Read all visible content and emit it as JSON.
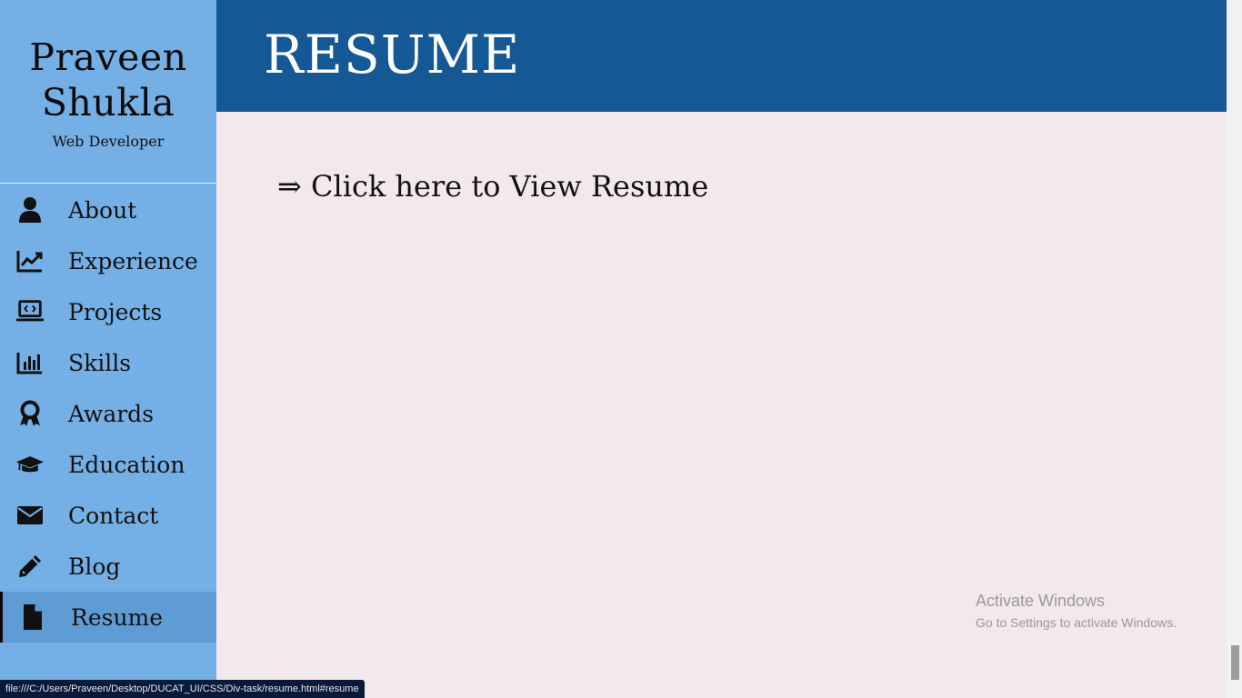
{
  "profile": {
    "name": "Praveen Shukla",
    "role": "Web Developer"
  },
  "nav": {
    "items": [
      {
        "label": "About",
        "icon": "user-icon"
      },
      {
        "label": "Experience",
        "icon": "chart-line-icon"
      },
      {
        "label": "Projects",
        "icon": "laptop-code-icon"
      },
      {
        "label": "Skills",
        "icon": "bar-chart-icon"
      },
      {
        "label": "Awards",
        "icon": "award-icon"
      },
      {
        "label": "Education",
        "icon": "graduation-cap-icon"
      },
      {
        "label": "Contact",
        "icon": "envelope-icon"
      },
      {
        "label": "Blog",
        "icon": "pencil-icon"
      },
      {
        "label": "Resume",
        "icon": "file-icon",
        "active": true
      }
    ]
  },
  "header": {
    "title": "RESUME"
  },
  "main": {
    "resume_link": "⇒ Click here to View Resume"
  },
  "watermark": {
    "title": "Activate Windows",
    "subtitle": "Go to Settings to activate Windows."
  },
  "statusbar": {
    "url": "file:///C:/Users/Praveen/Desktop/DUCAT_UI/CSS/Div-task/resume.html#resume"
  },
  "colors": {
    "sidebar": "#74b0e6",
    "header": "#145895",
    "background": "#f3e8ec",
    "active_item": "#5f9cd6"
  }
}
